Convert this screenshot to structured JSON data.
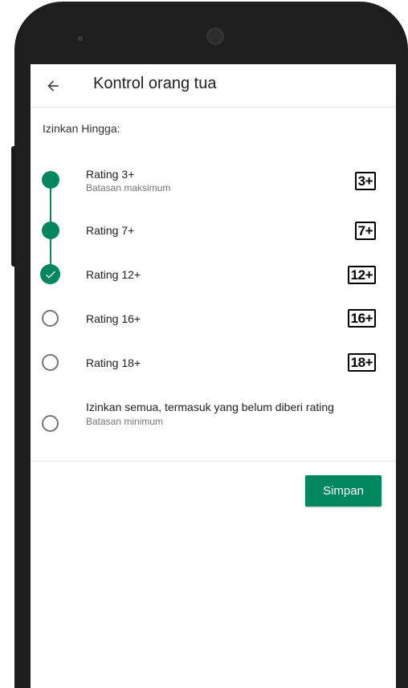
{
  "app_bar": {
    "back_icon": "arrow-left-icon",
    "title": "Kontrol orang tua"
  },
  "section_label": "Izinkan Hingga:",
  "accent_color": "#01875f",
  "options": [
    {
      "title": "Rating 3+",
      "subtitle": "Batasan maksimum",
      "badge": "3+",
      "state": "included"
    },
    {
      "title": "Rating 7+",
      "subtitle": "",
      "badge": "7+",
      "state": "included"
    },
    {
      "title": "Rating 12+",
      "subtitle": "",
      "badge": "12+",
      "state": "selected"
    },
    {
      "title": "Rating 16+",
      "subtitle": "",
      "badge": "16+",
      "state": "unselected"
    },
    {
      "title": "Rating 18+",
      "subtitle": "",
      "badge": "18+",
      "state": "unselected"
    },
    {
      "title": "Izinkan semua, termasuk yang belum diberi rating",
      "subtitle": "Batasan minimum",
      "badge": "",
      "state": "unselected"
    }
  ],
  "save_label": "Simpan"
}
